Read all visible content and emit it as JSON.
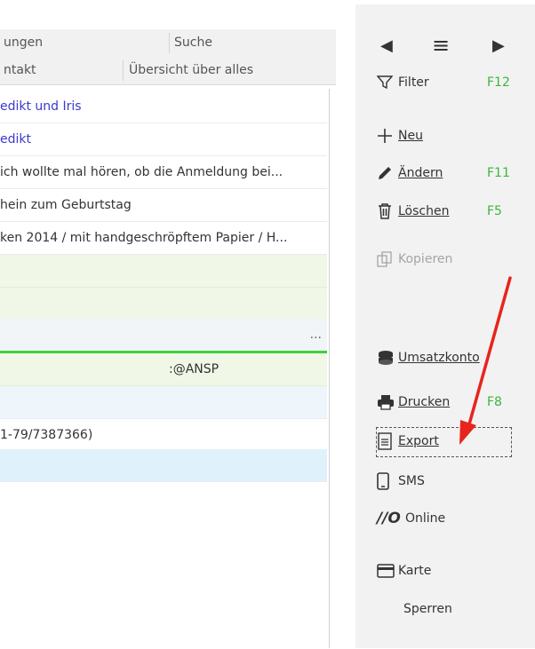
{
  "tabs_row1": [
    "ungen",
    "Suche"
  ],
  "tabs_row2": [
    "ntakt",
    "Übersicht über alles"
  ],
  "list_rows": [
    "edikt und Iris",
    "edikt",
    "ich wollte mal hören, ob die Anmeldung bei...",
    "hein zum Geburtstag",
    "ken 2014 / mit handgeschröpftem Papier / H...",
    "",
    "",
    "...",
    ":@ANSP",
    "",
    "1-79/7387366)",
    ""
  ],
  "sidebar": {
    "nav": {
      "prev": "◀",
      "menu": "≡",
      "next": "▶"
    },
    "filter": {
      "label": "Filter",
      "key": "F12"
    },
    "neu": {
      "label": "Neu"
    },
    "aendern": {
      "label": "Ändern",
      "key": "F11"
    },
    "loeschen": {
      "label": "Löschen",
      "key": "F5"
    },
    "kopieren": {
      "label": "Kopieren"
    },
    "umsatzkonto": {
      "label": "Umsatzkonto"
    },
    "drucken": {
      "label": "Drucken",
      "key": "F8"
    },
    "export": {
      "label": "Export"
    },
    "sms": {
      "label": "SMS"
    },
    "online": {
      "label": "Online",
      "icon_text": "//O"
    },
    "karte": {
      "label": "Karte"
    },
    "sperren": {
      "label": "Sperren"
    }
  },
  "colors": {
    "accent_arrow": "#e8241c",
    "fkey_green": "#3bb53b",
    "link_blue": "#3a3ad1",
    "divider_green": "#3cd13c"
  }
}
